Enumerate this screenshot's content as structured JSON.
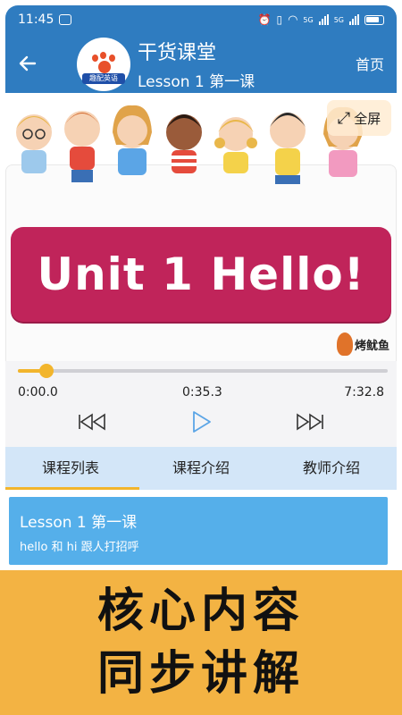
{
  "status_bar": {
    "time": "11:45",
    "network_1": "5G",
    "network_2": "5G"
  },
  "app_bar": {
    "logo_tag": "趣配英语",
    "title": "干货课堂",
    "subtitle": "Lesson 1 第一课",
    "home_label": "首页"
  },
  "video": {
    "title_text": "Unit  1  Hello!",
    "fullscreen_label": "全屏",
    "watermark": "烤鱿鱼"
  },
  "player": {
    "progress": 0.078,
    "current_time": "0:00.0",
    "middle_time": "0:35.3",
    "total_time": "7:32.8"
  },
  "tabs": [
    {
      "label": "课程列表",
      "active": true
    },
    {
      "label": "课程介绍",
      "active": false
    },
    {
      "label": "教师介绍",
      "active": false
    }
  ],
  "lessons": [
    {
      "title": "Lesson 1 第一课",
      "desc": "hello 和 hi 跟人打招呼"
    }
  ],
  "promo": {
    "line1": "核心内容",
    "line2": "同步讲解"
  },
  "colors": {
    "primary": "#2F7CC0",
    "accent": "#F2B52C",
    "banner": "#C0245A",
    "tab_bg": "#D3E6F8",
    "list_item": "#55AFEA",
    "promo_bg": "#F3B343"
  }
}
